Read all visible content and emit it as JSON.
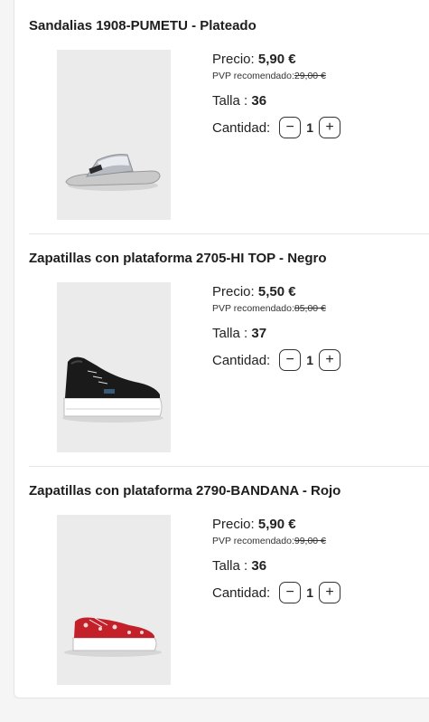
{
  "labels": {
    "price": "Precio:",
    "pvp": "PVP recomendado:",
    "size": "Talla :",
    "quantity": "Cantidad:",
    "minus": "−",
    "plus": "+"
  },
  "items": [
    {
      "title": "Sandalias 1908-PUMETU - Plateado",
      "price": "5,90 €",
      "pvp": "29,00 €",
      "size": "36",
      "quantity": "1",
      "image": "silver-slide-sandal"
    },
    {
      "title": "Zapatillas con plataforma 2705-HI TOP - Negro",
      "price": "5,50 €",
      "pvp": "85,00 €",
      "size": "37",
      "quantity": "1",
      "image": "black-high-top-platform-sneaker"
    },
    {
      "title": "Zapatillas con plataforma 2790-BANDANA - Rojo",
      "price": "5,90 €",
      "pvp": "99,00 €",
      "size": "36",
      "quantity": "1",
      "image": "red-bandana-platform-sneaker"
    }
  ]
}
